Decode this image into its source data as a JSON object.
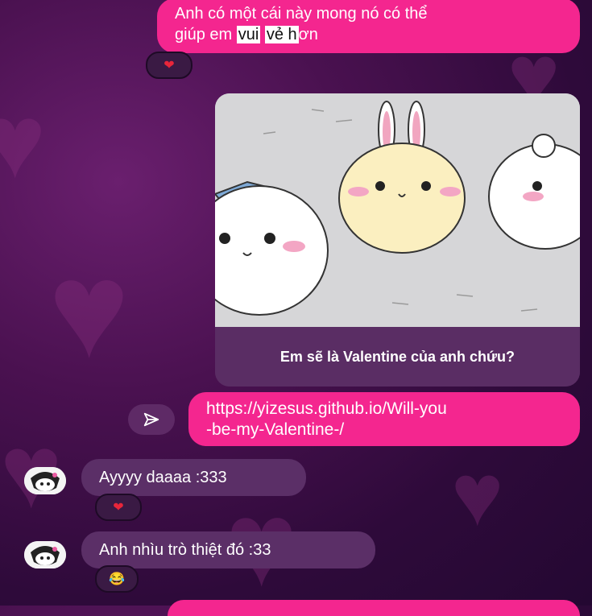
{
  "messages": {
    "out1": {
      "line1": "Anh có một cái này mong nó có thể",
      "pre": "giúp em ",
      "hl1": "vui",
      "mid": " ",
      "hl2": "vẻ h",
      "post": "ơn"
    },
    "card": {
      "caption": "Em sẽ là Valentine của anh chứu?"
    },
    "out2": {
      "line1": "https://yizesus.github.io/Will-you",
      "line2": "-be-my-Valentine-/"
    },
    "in1": {
      "text": "Ayyyy daaaa :333"
    },
    "in2": {
      "text": "Anh nhìu trò thiệt đó :33"
    }
  },
  "reactions": {
    "heart": "❤",
    "laugh": "😂"
  },
  "icons": [
    "heart-icon",
    "send-icon",
    "laugh-emoji-icon",
    "avatar-icon"
  ],
  "colors": {
    "outgoing_bubble": "#f4268f",
    "incoming_bubble": "#5b2f67",
    "background": "#3a0e45"
  }
}
